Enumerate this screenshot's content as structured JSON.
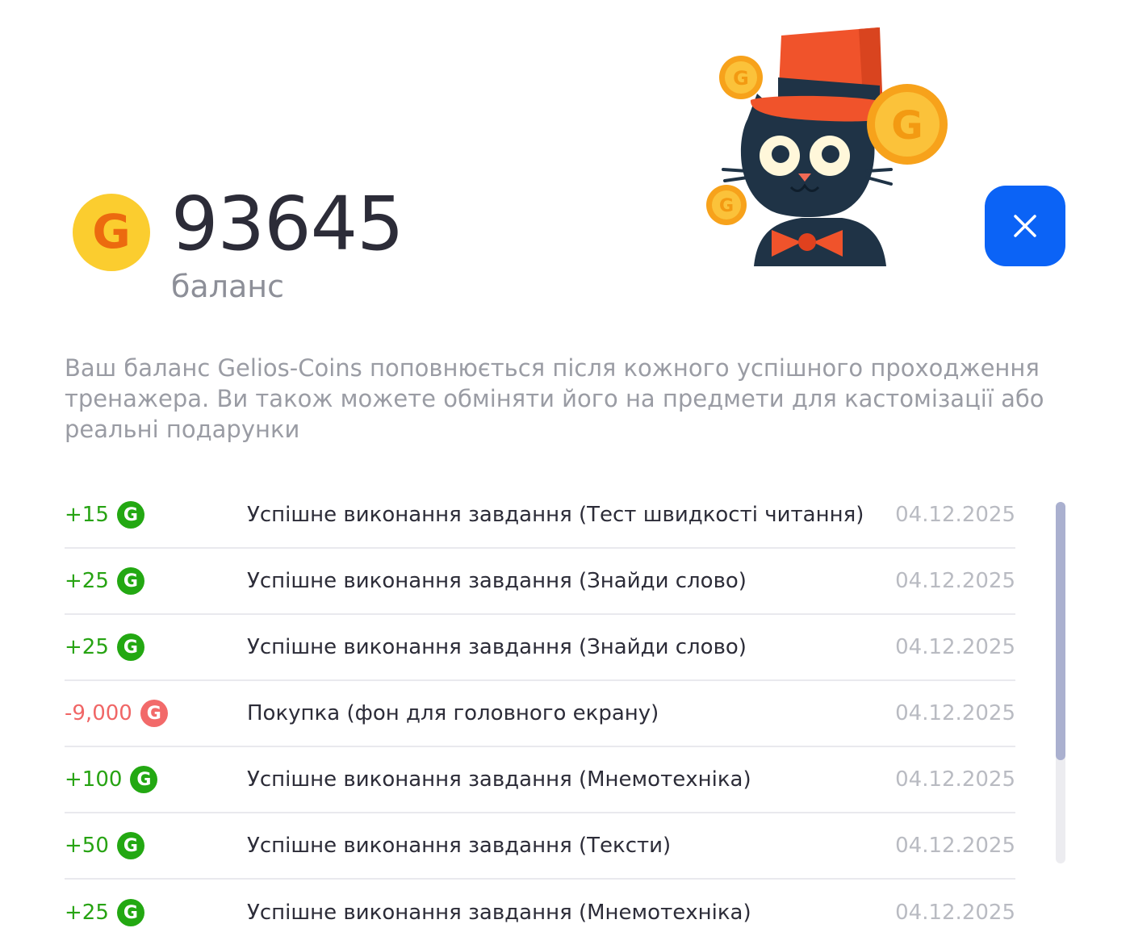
{
  "balance": {
    "coin_letter": "G",
    "value": "93645",
    "label": "баланс"
  },
  "close_icon": "close-icon",
  "description": "Ваш баланс Gelios-Coins поповнюється після кожного успішного проходження тренажера. Ви також можете обміняти його на предмети для кастомізації або реальні подарунки",
  "history": [
    {
      "amount": "+15",
      "type": "pos",
      "coin": "G",
      "text": "Успішне виконання завдання (Тест швидкості читання)",
      "date": "04.12.2025"
    },
    {
      "amount": "+25",
      "type": "pos",
      "coin": "G",
      "text": "Успішне виконання завдання (Знайди слово)",
      "date": "04.12.2025"
    },
    {
      "amount": "+25",
      "type": "pos",
      "coin": "G",
      "text": "Успішне виконання завдання (Знайди слово)",
      "date": "04.12.2025"
    },
    {
      "amount": "-9,000",
      "type": "neg",
      "coin": "G",
      "text": "Покупка (фон для головного екрану)",
      "date": "04.12.2025"
    },
    {
      "amount": "+100",
      "type": "pos",
      "coin": "G",
      "text": "Успішне виконання завдання (Мнемотехніка)",
      "date": "04.12.2025"
    },
    {
      "amount": "+50",
      "type": "pos",
      "coin": "G",
      "text": "Успішне виконання завдання (Тексти)",
      "date": "04.12.2025"
    },
    {
      "amount": "+25",
      "type": "pos",
      "coin": "G",
      "text": "Успішне виконання завдання (Мнемотехніка)",
      "date": "04.12.2025"
    }
  ],
  "colors": {
    "accent": "#0b63f6",
    "positive": "#27a313",
    "negative": "#f06666",
    "coin": "#fbcd2f"
  }
}
